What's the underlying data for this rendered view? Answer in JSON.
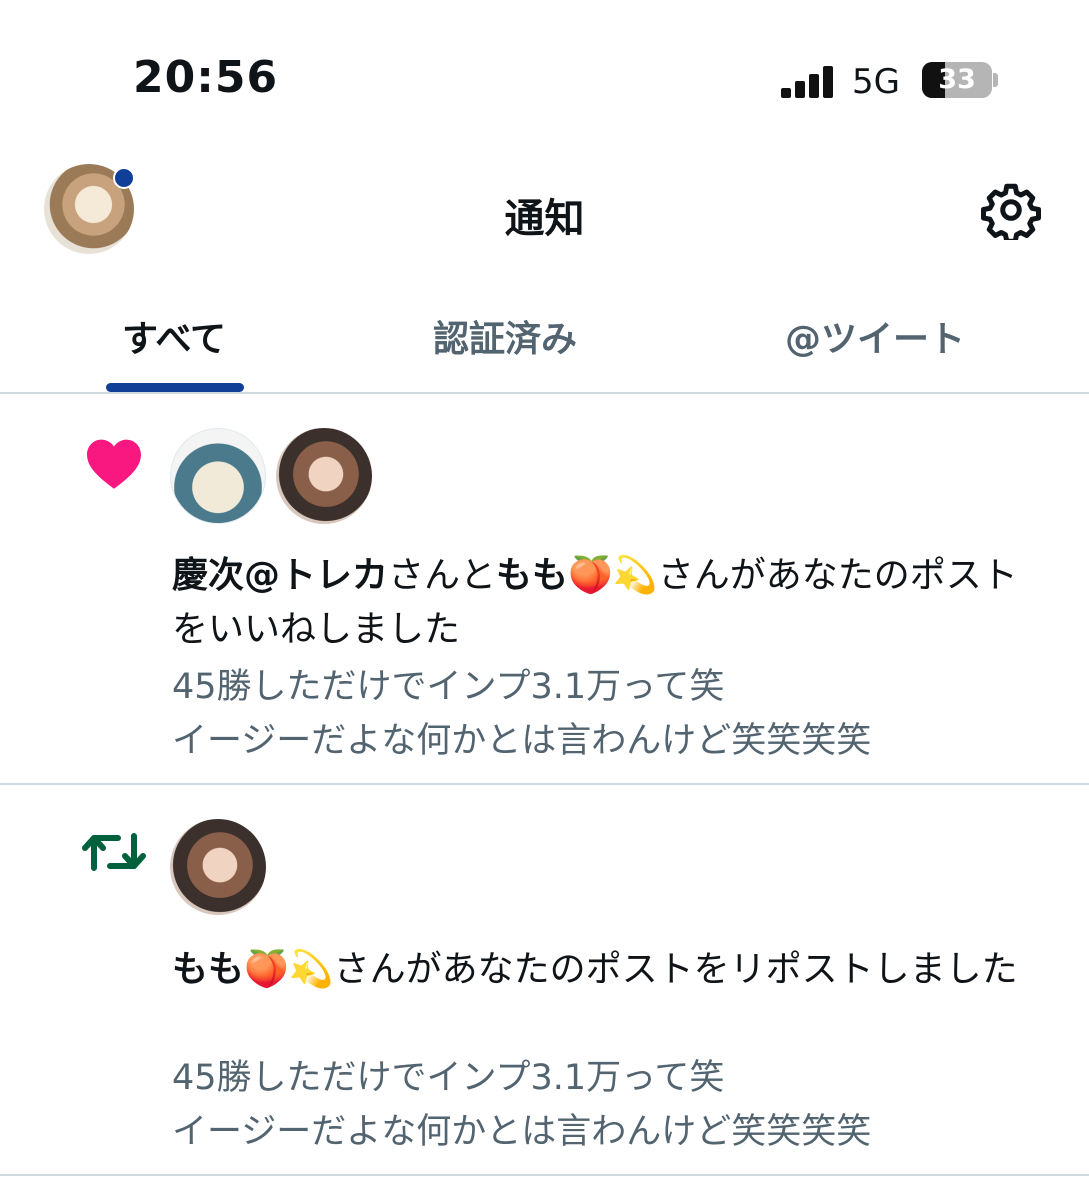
{
  "status_bar": {
    "time": "20:56",
    "network": "5G",
    "battery_level": "33"
  },
  "header": {
    "title": "通知"
  },
  "tabs": [
    {
      "label": "すべて",
      "active": true
    },
    {
      "label": "認証済み",
      "active": false
    },
    {
      "label": "@ツイート",
      "active": false
    }
  ],
  "notifications": [
    {
      "type": "like",
      "icon": "heart-icon",
      "users": [
        {
          "name": "慶次@トレカ",
          "suffix": "さんと"
        },
        {
          "name": "もも🍑💫",
          "suffix": "さんがあなたのポストをいいねしました"
        }
      ],
      "post_lines": [
        "45勝しただけでインプ3.1万って笑",
        "イージーだよな何かとは言わんけど笑笑笑笑"
      ]
    },
    {
      "type": "repost",
      "icon": "repost-icon",
      "users": [
        {
          "name": "もも🍑💫",
          "suffix": "さんがあなたのポストをリポストしました"
        }
      ],
      "post_lines": [
        "45勝しただけでインプ3.1万って笑",
        "イージーだよな何かとは言わんけど笑笑笑笑"
      ]
    }
  ],
  "colors": {
    "accent": "#103f98",
    "like": "#f91880",
    "repost": "#00613c",
    "secondary_text": "#536471",
    "divider": "#cfd9de"
  }
}
